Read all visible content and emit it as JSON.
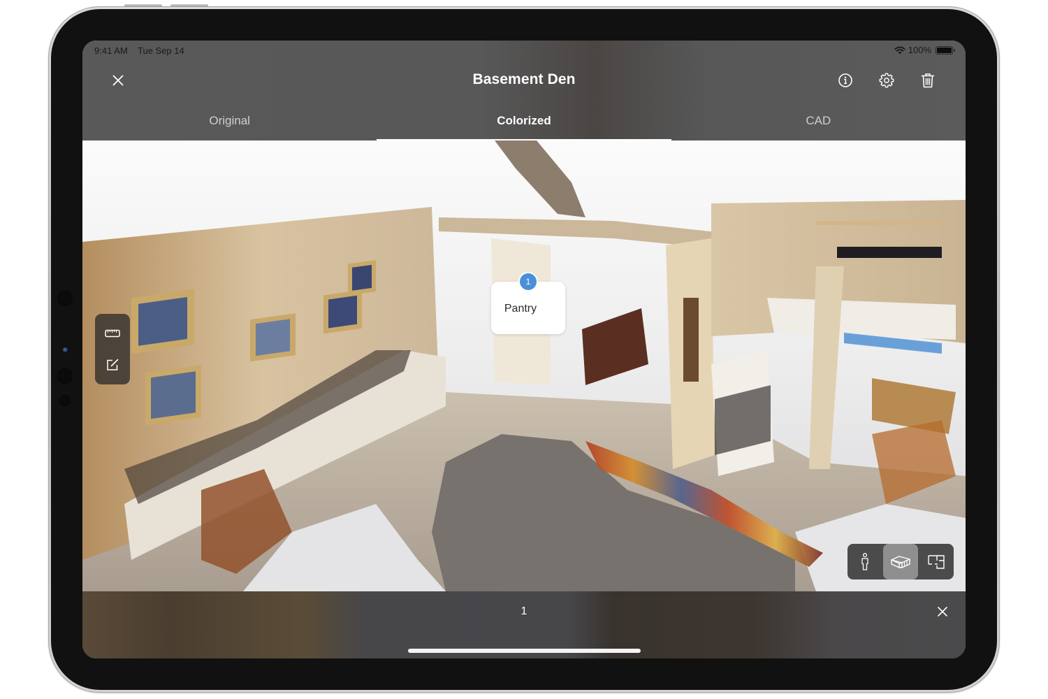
{
  "status_bar": {
    "time": "9:41 AM",
    "date": "Tue Sep 14",
    "battery_percent": "100%",
    "wifi_icon": "wifi-icon",
    "battery_icon": "battery-full-icon"
  },
  "nav": {
    "title": "Basement Den",
    "close_icon": "close-icon",
    "actions": [
      {
        "name": "info",
        "icon": "info-circle-icon"
      },
      {
        "name": "settings",
        "icon": "gear-icon"
      },
      {
        "name": "delete",
        "icon": "trash-icon"
      }
    ]
  },
  "tabs": [
    {
      "label": "Original",
      "active": false
    },
    {
      "label": "Colorized",
      "active": true
    },
    {
      "label": "CAD",
      "active": false
    }
  ],
  "viewport": {
    "tools": [
      {
        "name": "measure",
        "icon": "ruler-icon"
      },
      {
        "name": "annotate",
        "icon": "edit-note-icon"
      }
    ],
    "pins": [
      {
        "number": "1",
        "label": "Pantry"
      }
    ],
    "view_modes": [
      {
        "name": "first-person",
        "icon": "person-icon",
        "active": false
      },
      {
        "name": "dollhouse-3d",
        "icon": "3d-box-icon",
        "active": true
      },
      {
        "name": "floor-plan",
        "icon": "floor-plan-icon",
        "active": false
      }
    ]
  },
  "bottom_bar": {
    "count": "1",
    "close_icon": "close-icon"
  },
  "colors": {
    "chrome_gray": "#585858",
    "active_tab_text": "#ffffff",
    "inactive_tab_text": "#cfcfcf",
    "pin_badge": "#4a90d9",
    "view_mode_bg": "#4b4b4b",
    "view_mode_active": "#8f8f8f"
  }
}
